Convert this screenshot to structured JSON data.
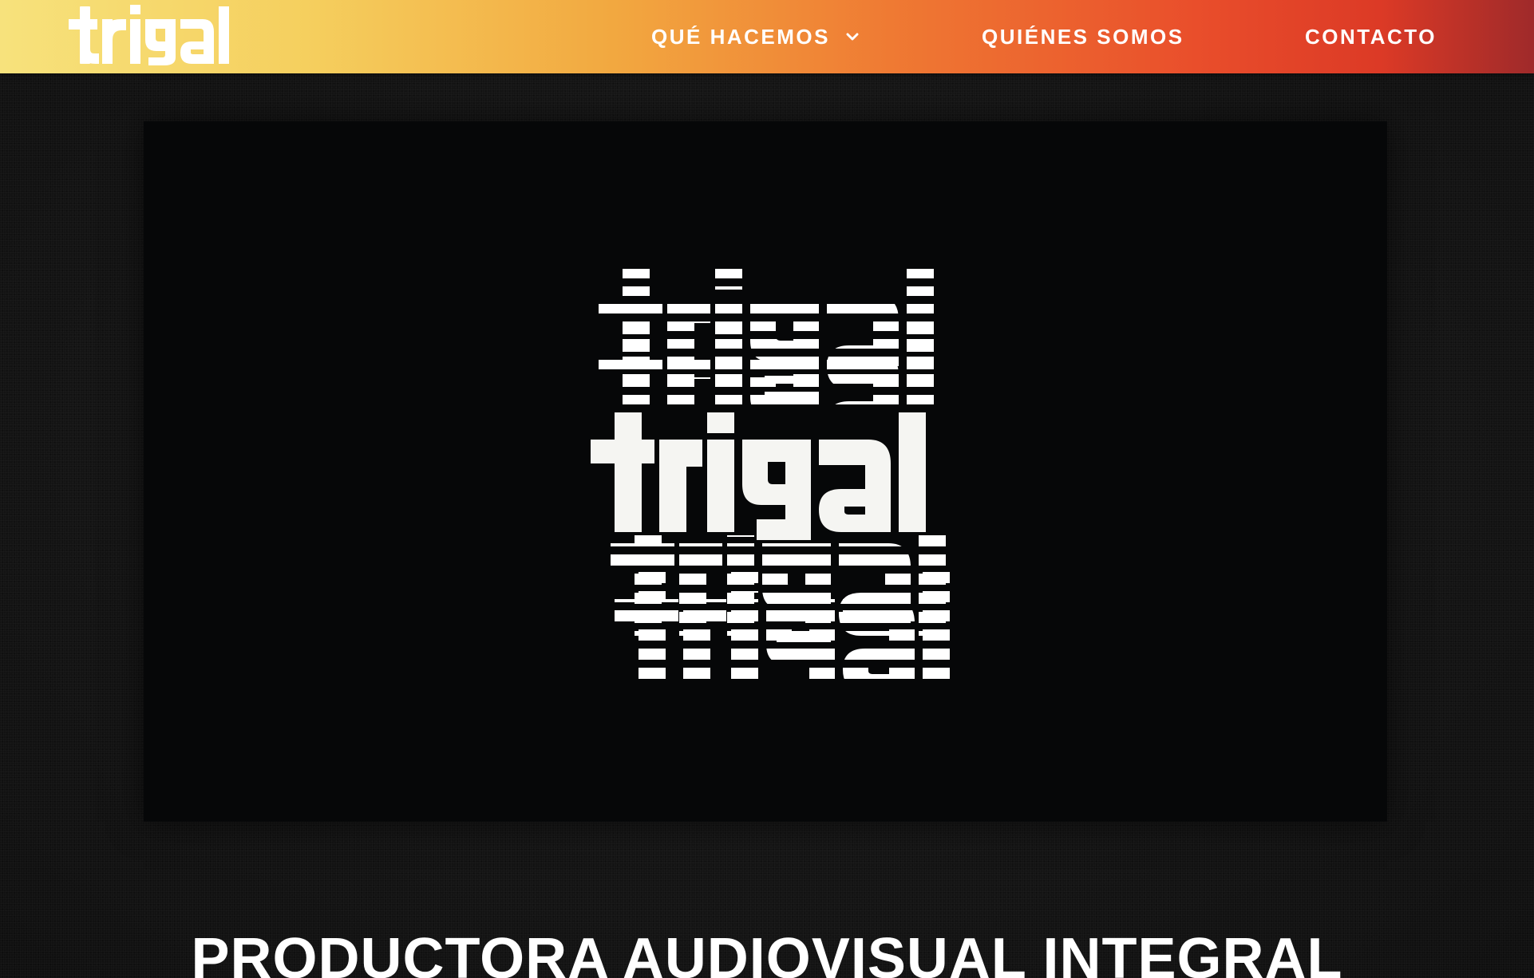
{
  "header": {
    "logo_text": "trigal",
    "nav": {
      "que_hacemos": "QUÉ HACEMOS",
      "quienes_somos": "QUIÉNES SOMOS",
      "contacto": "CONTACTO"
    },
    "icons": {
      "dropdown": "chevron-down-icon"
    }
  },
  "hero": {
    "logo_text": "trigal"
  },
  "main": {
    "headline": "PRODUCTORA AUDIOVISUAL INTEGRAL"
  },
  "colors": {
    "header_gradient_start": "#f7e27c",
    "header_gradient_mid": "#ef7a33",
    "header_gradient_end": "#9f2a2a",
    "background": "#161616",
    "hero_background": "#060708",
    "text": "#ffffff"
  }
}
